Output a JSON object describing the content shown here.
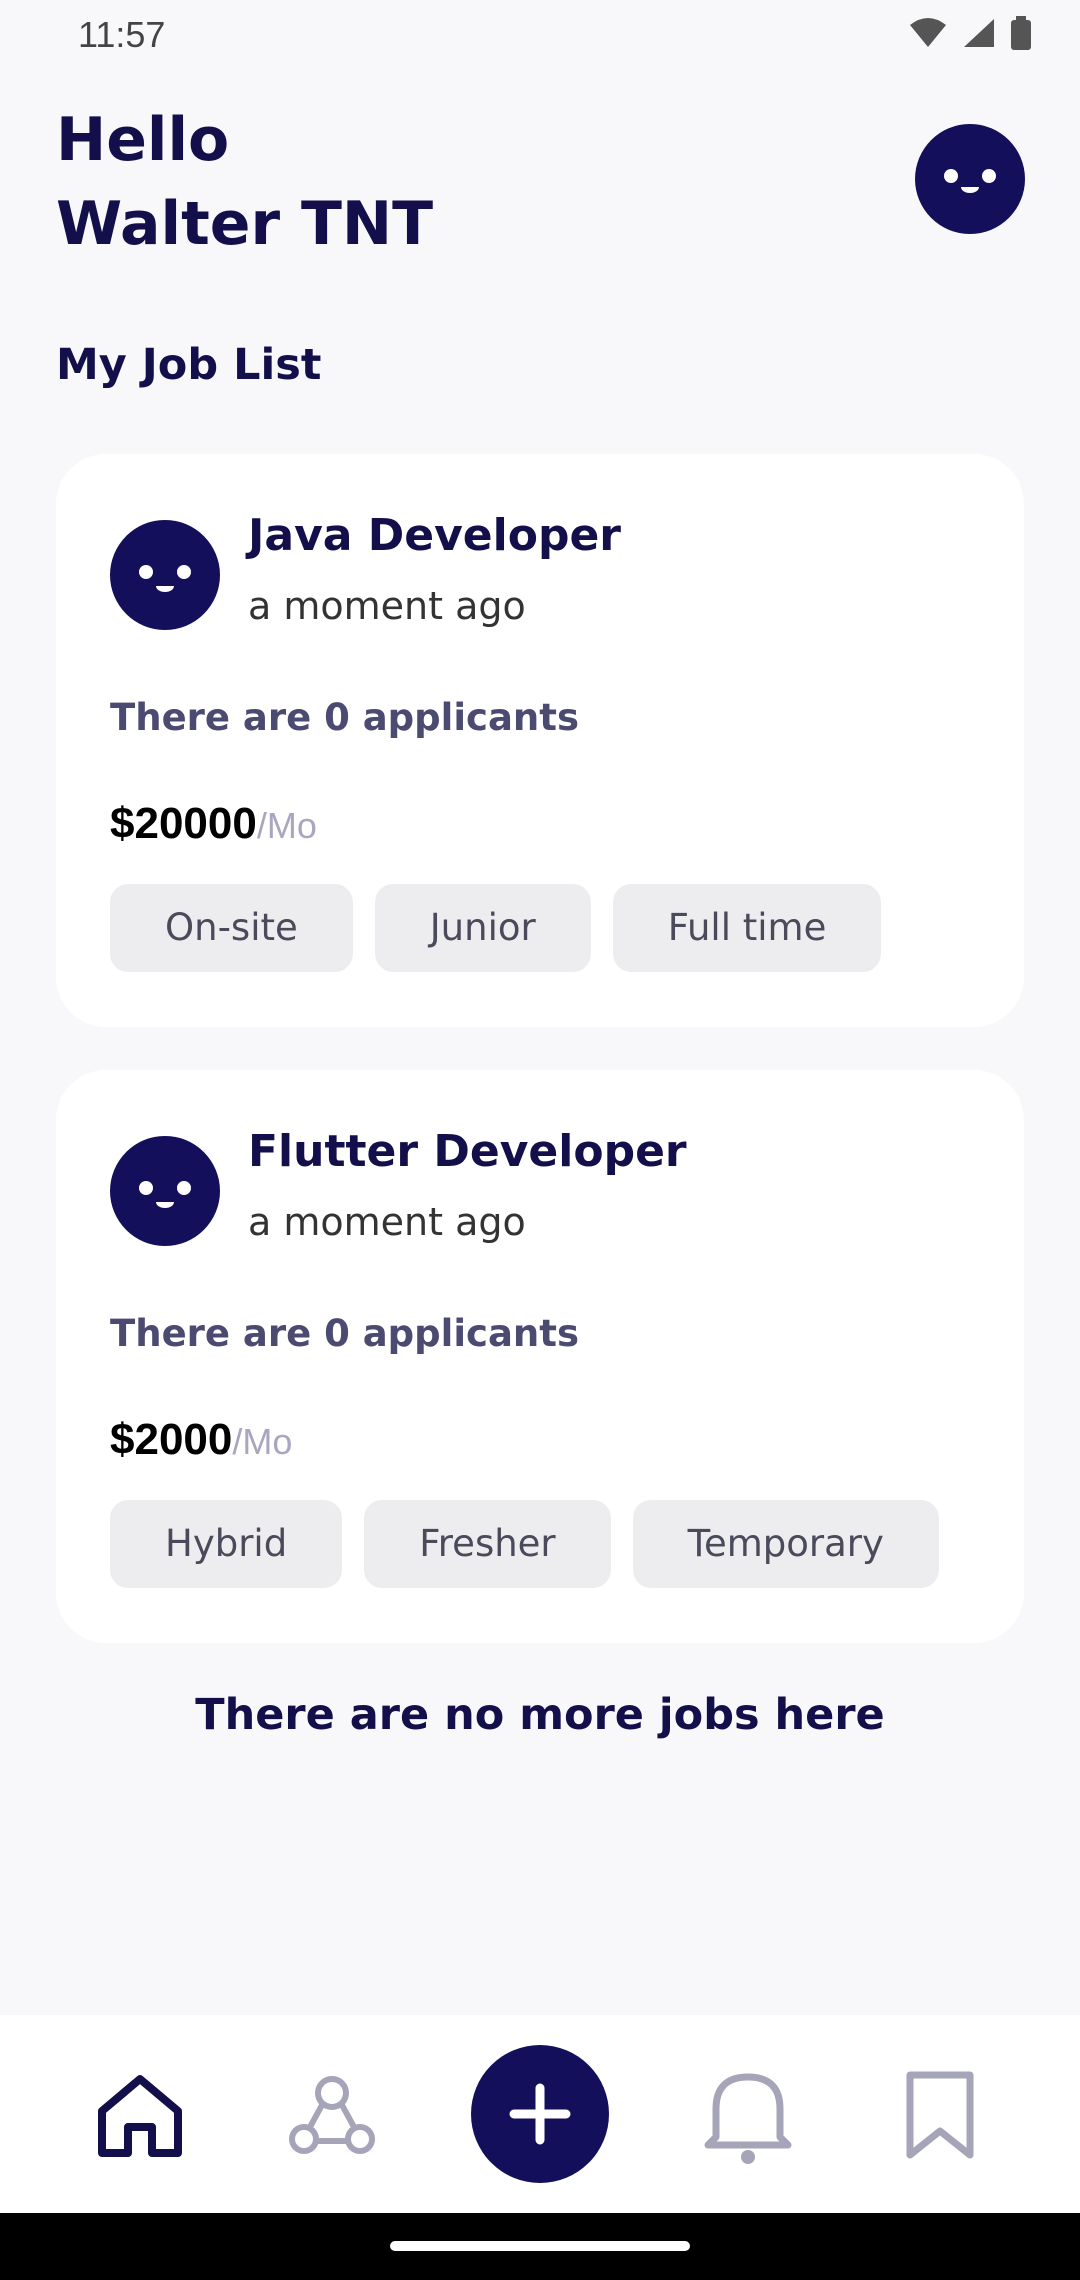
{
  "status": {
    "time": "11:57"
  },
  "header": {
    "greeting_line1": "Hello",
    "greeting_line2": "Walter TNT"
  },
  "section": {
    "title": "My Job List"
  },
  "jobs": [
    {
      "title": "Java Developer",
      "time": "a moment ago",
      "applicants": "There are 0 applicants",
      "salary": "$20000",
      "per": "/Mo",
      "tags": [
        "On-site",
        "Junior",
        "Full time"
      ]
    },
    {
      "title": "Flutter Developer",
      "time": "a moment ago",
      "applicants": "There are 0 applicants",
      "salary": "$2000",
      "per": "/Mo",
      "tags": [
        "Hybrid",
        "Fresher",
        "Temporary"
      ]
    }
  ],
  "footer_message": "There are no more jobs here",
  "nav": {
    "items": [
      "home-icon",
      "network-icon",
      "add-icon",
      "bell-icon",
      "bookmark-icon"
    ],
    "active": "home-icon"
  },
  "colors": {
    "primary": "#130f5a",
    "background": "#f8f8fa",
    "tag_bg": "#ededf0"
  }
}
